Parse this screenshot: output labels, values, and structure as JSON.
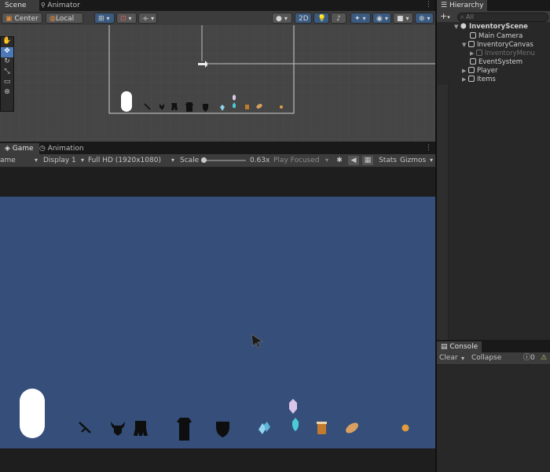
{
  "scene_panel": {
    "tabs": [
      {
        "label": "Scene"
      },
      {
        "label": "Animator"
      }
    ],
    "toolbar": {
      "pivot_mode": "Center",
      "pivot_space": "Local",
      "mode_2d": "2D"
    },
    "tools": [
      "hand-tool",
      "move-tool",
      "rotate-tool",
      "scale-tool",
      "rect-tool",
      "transform-tool"
    ]
  },
  "game_panel": {
    "tabs": [
      {
        "label": "Game"
      },
      {
        "label": "Animation"
      }
    ],
    "toolbar": {
      "view_mode": "ame",
      "display": "Display 1",
      "resolution": "Full HD (1920x1080)",
      "scale_label": "Scale",
      "scale_value": 0.63,
      "scale_text": "0.63x",
      "play_focus": "Play Focused",
      "stats": "Stats",
      "gizmos": "Gizmos"
    },
    "background_color": "#354e7a",
    "item_icons": [
      "capsule",
      "sword-icon",
      "horned-helmet-icon",
      "boots-icon",
      "armor-icon",
      "shield-icon",
      "crystal-icon",
      "potion-icon",
      "gem-icon",
      "drink-cup-icon",
      "bread-icon",
      "coin-icon"
    ]
  },
  "hierarchy": {
    "title": "Hierarchy",
    "add_label": "+",
    "search_placeholder": "All",
    "scene": "InventoryScene",
    "items": [
      {
        "label": "Main Camera"
      },
      {
        "label": "InventoryCanvas"
      },
      {
        "label": "InventoryMenu"
      },
      {
        "label": "EventSystem"
      },
      {
        "label": "Player"
      },
      {
        "label": "Items"
      }
    ]
  },
  "console": {
    "title": "Console",
    "clear": "Clear",
    "collapse": "Collapse",
    "count": "0"
  }
}
